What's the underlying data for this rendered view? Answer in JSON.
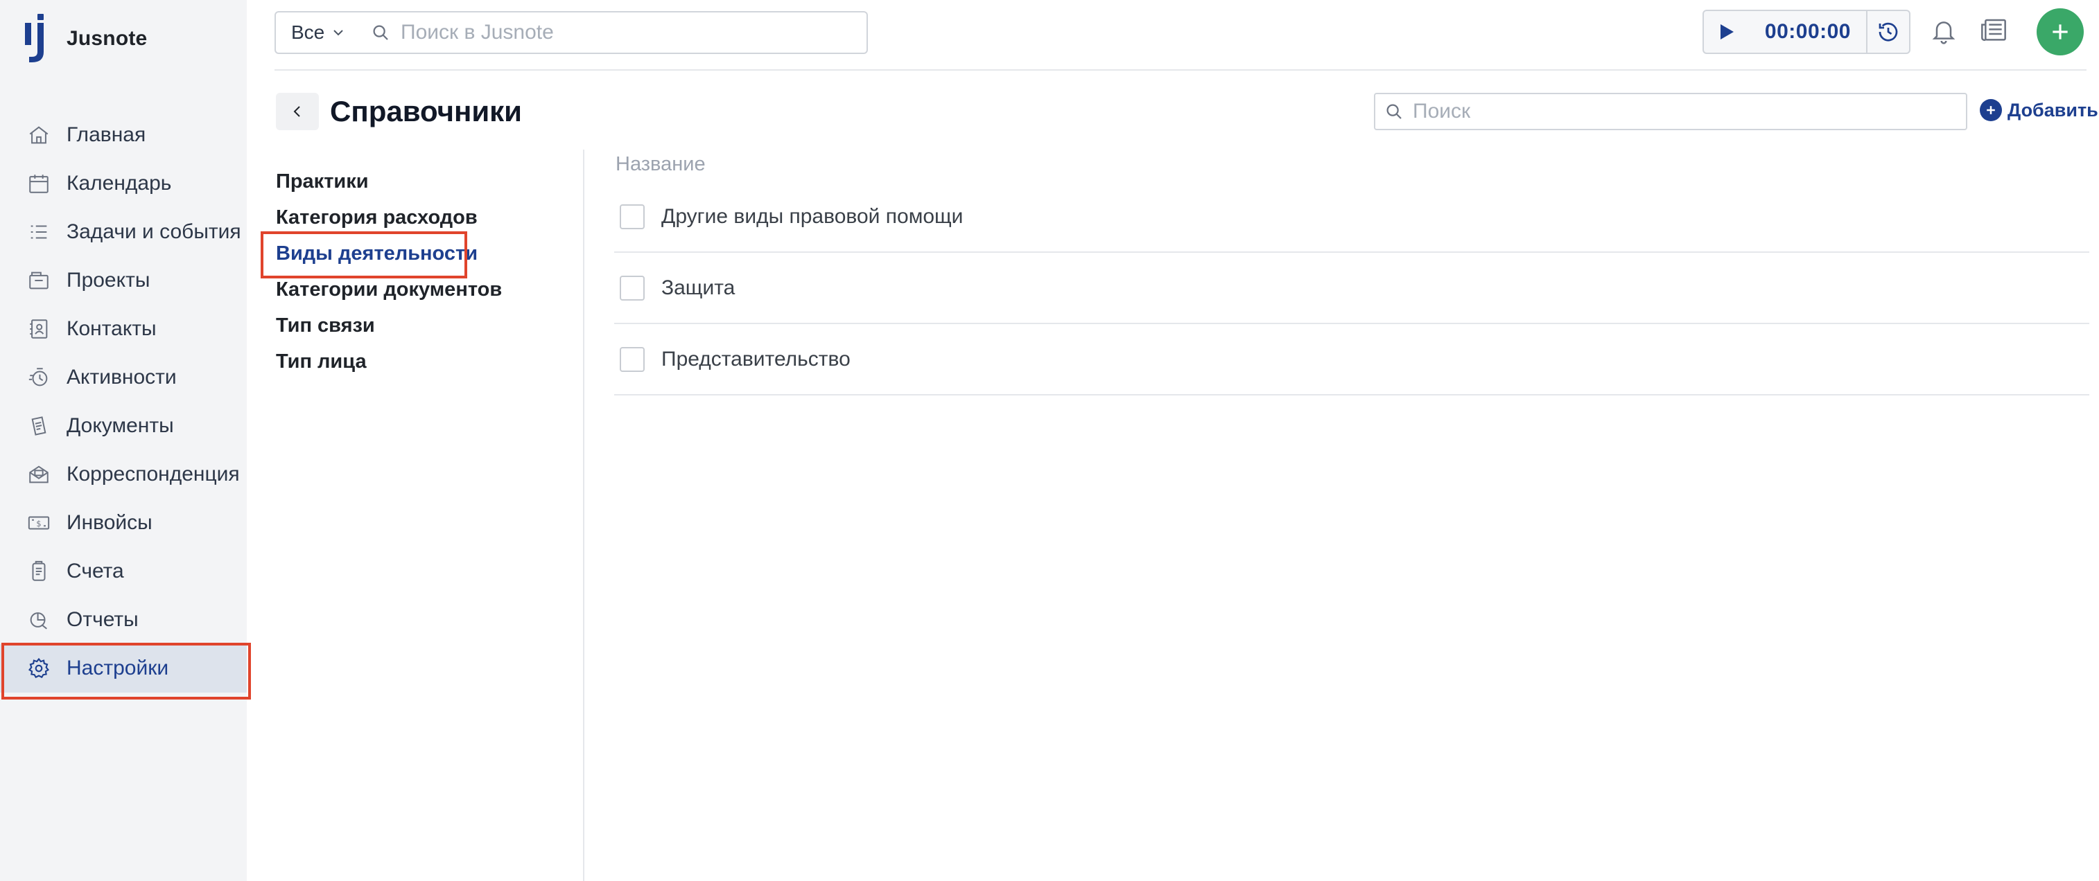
{
  "brand": {
    "name": "Jusnote"
  },
  "sidebar": {
    "items": [
      {
        "label": "Главная",
        "icon": "home-icon"
      },
      {
        "label": "Календарь",
        "icon": "calendar-icon"
      },
      {
        "label": "Задачи и события",
        "icon": "tasks-icon"
      },
      {
        "label": "Проекты",
        "icon": "projects-icon"
      },
      {
        "label": "Контакты",
        "icon": "contacts-icon"
      },
      {
        "label": "Активности",
        "icon": "activity-icon"
      },
      {
        "label": "Документы",
        "icon": "documents-icon"
      },
      {
        "label": "Корреспонденция",
        "icon": "correspondence-icon"
      },
      {
        "label": "Инвойсы",
        "icon": "invoice-icon"
      },
      {
        "label": "Счета",
        "icon": "accounts-icon"
      },
      {
        "label": "Отчеты",
        "icon": "reports-icon"
      },
      {
        "label": "Настройки",
        "icon": "gear-icon",
        "active": true
      }
    ]
  },
  "topbar": {
    "scope": "Все",
    "search_placeholder": "Поиск в Jusnote",
    "timer": "00:00:00"
  },
  "page": {
    "title": "Справочники",
    "search_placeholder": "Поиск",
    "add_label": "Добавить"
  },
  "dictionaries": {
    "items": [
      {
        "label": "Практики"
      },
      {
        "label": "Категория расходов"
      },
      {
        "label": "Виды деятельности",
        "active": true
      },
      {
        "label": "Категории документов"
      },
      {
        "label": "Тип связи"
      },
      {
        "label": "Тип лица"
      }
    ]
  },
  "table": {
    "column_header": "Название",
    "rows": [
      {
        "name": "Другие виды правовой помощи"
      },
      {
        "name": "Защита"
      },
      {
        "name": "Представительство"
      }
    ]
  },
  "colors": {
    "accent": "#1d3f8f",
    "add_button": "#3aa868",
    "highlight_box": "#e0442c",
    "sidebar_bg": "#f3f4f6"
  }
}
